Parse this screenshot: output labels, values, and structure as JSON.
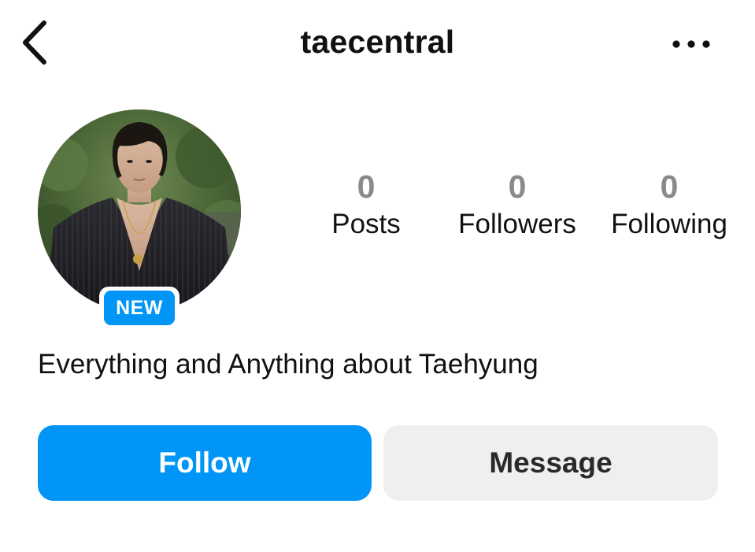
{
  "header": {
    "title": "taecentral",
    "back_icon": "chevron-left-icon",
    "more_icon": "more-horizontal-icon"
  },
  "profile": {
    "badge": "NEW",
    "bio": "Everything and Anything about Taehyung"
  },
  "stats": [
    {
      "value": "0",
      "label": "Posts"
    },
    {
      "value": "0",
      "label": "Followers"
    },
    {
      "value": "0",
      "label": "Following"
    }
  ],
  "actions": {
    "follow_label": "Follow",
    "message_label": "Message"
  },
  "colors": {
    "accent": "#0095f6",
    "secondary_button": "#efefef",
    "stat_number": "#8a8a8a",
    "text": "#111111"
  }
}
